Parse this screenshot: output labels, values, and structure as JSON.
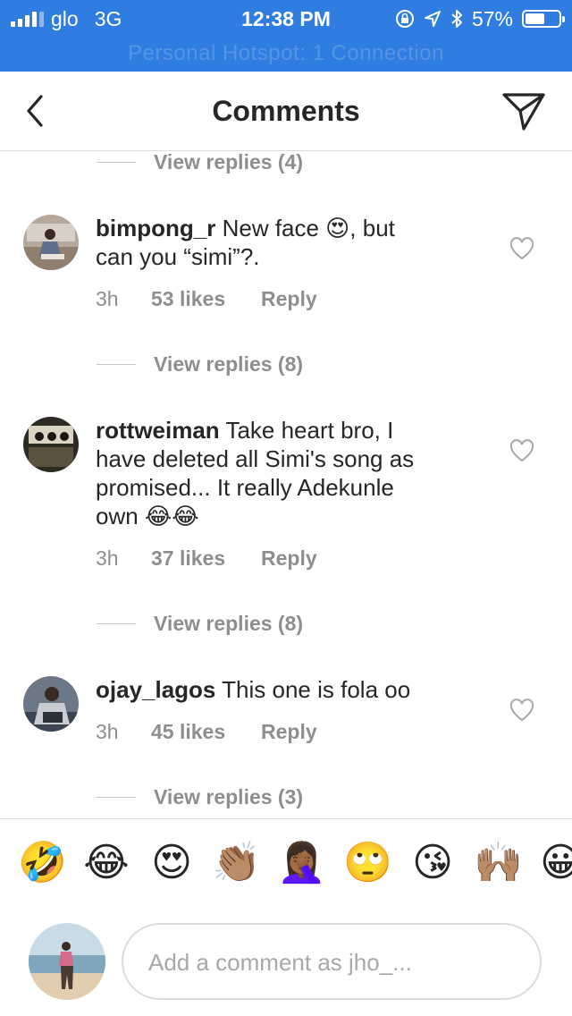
{
  "status_bar": {
    "carrier": "glo",
    "network": "3G",
    "time": "12:38 PM",
    "battery_text": "57%",
    "battery_level": 0.57,
    "hotspot_text": "Personal Hotspot: 1 Connection"
  },
  "header": {
    "title": "Comments",
    "back_icon": "chevron-left-icon",
    "send_icon": "paper-plane-icon"
  },
  "view_replies": [
    "View replies (4)",
    "View replies (8)",
    "View replies (8)",
    "View replies (3)"
  ],
  "comments": [
    {
      "username": "bimpong_r",
      "lines": [
        "New face 😍, but",
        "can you “simi”?."
      ],
      "time": "3h",
      "likes": "53 likes",
      "reply": "Reply"
    },
    {
      "username": "rottweiman",
      "lines": [
        "Take heart bro, I",
        "have deleted all Simi's song as",
        "promised... It really Adekunle",
        "own 😂😂"
      ],
      "time": "3h",
      "likes": "37 likes",
      "reply": "Reply"
    },
    {
      "username": "ojay_lagos",
      "lines": [
        "This one is fola oo"
      ],
      "time": "3h",
      "likes": "45 likes",
      "reply": "Reply"
    }
  ],
  "emoji_bar": [
    "🤣",
    "😂",
    "😍",
    "👏🏽",
    "🤦🏾‍♀️",
    "🙄",
    "😘",
    "🙌🏽",
    "😀"
  ],
  "composer": {
    "placeholder": "Add a comment as jho_..."
  },
  "colors": {
    "status_bar": "#2f7de0",
    "text": "#262626",
    "muted": "#8e8e8e",
    "divider": "#dbdbdb"
  }
}
